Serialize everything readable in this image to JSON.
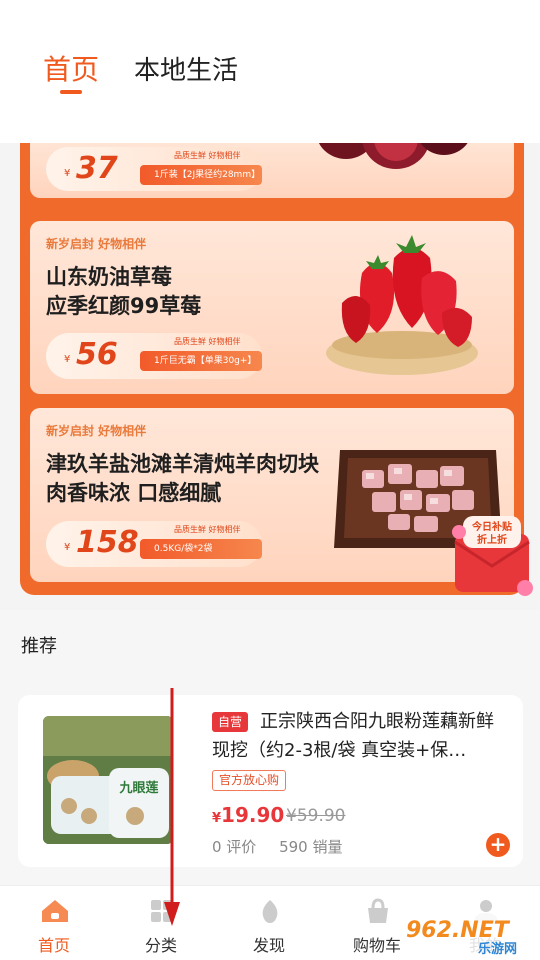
{
  "header": {
    "tabs": [
      {
        "label": "首页",
        "active": true
      },
      {
        "label": "本地生活",
        "active": false
      }
    ]
  },
  "promo": {
    "cards": [
      {
        "price": "37",
        "quality": "品质生鲜 好物相伴",
        "spec": "1斤装【2J果径约28mm】",
        "art": "plum-icon"
      },
      {
        "slogan": "新岁启封 好物相伴",
        "title_line1": "山东奶油草莓",
        "title_line2": "应季红颜99草莓",
        "price": "56",
        "quality": "品质生鲜 好物相伴",
        "spec": "1斤巨无霸【单果30g+】",
        "art": "strawberry-icon"
      },
      {
        "slogan": "新岁启封 好物相伴",
        "title_line1": "津玖羊盐池滩羊清炖羊肉切块",
        "title_line2": "肉香味浓 口感细腻",
        "price": "158",
        "quality": "品质生鲜 好物相伴",
        "spec": "0.5KG/袋*2袋",
        "art": "mutton-icon"
      }
    ],
    "currency": "¥",
    "sticker": {
      "line1": "今日补贴",
      "line2": "折上折"
    }
  },
  "recommend": {
    "title": "推荐",
    "product": {
      "badge": "自营",
      "name": "正宗陕西合阳九眼粉莲藕新鲜现挖（约2-3根/袋 真空装+保…",
      "tag": "官方放心购",
      "currency": "¥",
      "price": "19.90",
      "old_price": "¥59.90",
      "reviews": "0 评价",
      "sales": "590 销量",
      "thumb_text": "九眼莲"
    }
  },
  "nav": {
    "items": [
      {
        "label": "首页",
        "icon": "home-icon",
        "active": true
      },
      {
        "label": "分类",
        "icon": "category-icon",
        "active": false
      },
      {
        "label": "发现",
        "icon": "discover-icon",
        "active": false
      },
      {
        "label": "购物车",
        "icon": "cart-icon",
        "active": false
      },
      {
        "label": "我的",
        "icon": "profile-icon",
        "active": false
      }
    ]
  },
  "watermark": {
    "text": "962.NET",
    "sub": "乐游网"
  },
  "colors": {
    "accent": "#f05a1e",
    "price_red": "#e8373a"
  }
}
